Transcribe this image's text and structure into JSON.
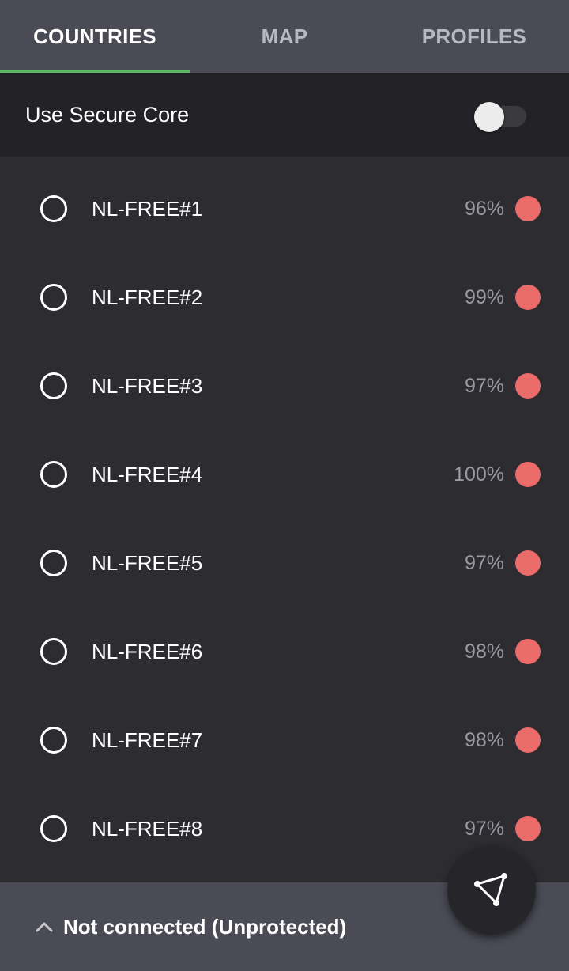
{
  "tabs": [
    {
      "label": "COUNTRIES",
      "active": true
    },
    {
      "label": "MAP",
      "active": false
    },
    {
      "label": "PROFILES",
      "active": false
    }
  ],
  "secure_core": {
    "label": "Use Secure Core",
    "enabled": false
  },
  "servers": [
    {
      "name": "NL-FREE#1",
      "load": "96%"
    },
    {
      "name": "NL-FREE#2",
      "load": "99%"
    },
    {
      "name": "NL-FREE#3",
      "load": "97%"
    },
    {
      "name": "NL-FREE#4",
      "load": "100%"
    },
    {
      "name": "NL-FREE#5",
      "load": "97%"
    },
    {
      "name": "NL-FREE#6",
      "load": "98%"
    },
    {
      "name": "NL-FREE#7",
      "load": "98%"
    },
    {
      "name": "NL-FREE#8",
      "load": "97%"
    }
  ],
  "status": {
    "text": "Not connected (Unprotected)",
    "chevron_icon": "chevron-up-icon"
  },
  "fab": {
    "icon": "triangle-network-icon"
  },
  "colors": {
    "accent": "#5ab866",
    "load_high": "#ec6b6b",
    "bar": "#4a4b55",
    "background": "#2c2c31"
  }
}
